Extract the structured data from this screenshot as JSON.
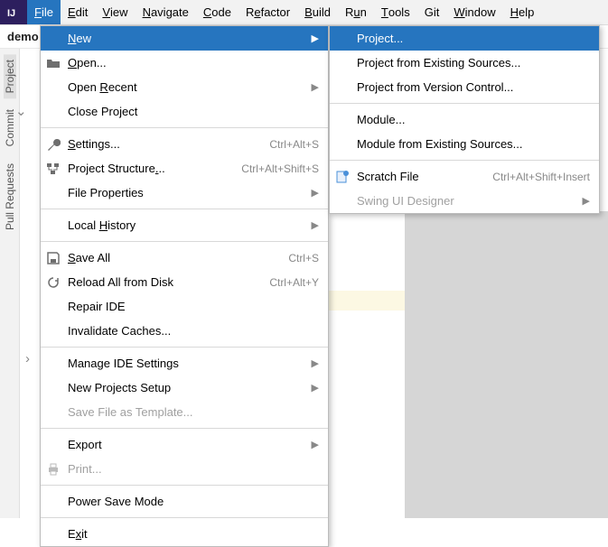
{
  "menubar": [
    "File",
    "Edit",
    "View",
    "Navigate",
    "Code",
    "Refactor",
    "Build",
    "Run",
    "Tools",
    "Git",
    "Window",
    "Help"
  ],
  "menubar_underline_idx": [
    0,
    0,
    0,
    0,
    0,
    1,
    0,
    1,
    0,
    -1,
    0,
    0
  ],
  "menubar_active": 0,
  "crumb": "demo",
  "left_tools": [
    {
      "label": "Project",
      "icon": "project"
    },
    {
      "label": "Commit",
      "icon": "commit"
    },
    {
      "label": "Pull Requests",
      "icon": "pr"
    }
  ],
  "file_menu": [
    {
      "label": "New",
      "underline": 0,
      "arrow": true,
      "highlight": true
    },
    {
      "icon": "open",
      "label": "Open...",
      "underline": 0
    },
    {
      "label": "Open Recent",
      "underline": 5,
      "arrow": true
    },
    {
      "label": "Close Project"
    },
    {
      "sep": true
    },
    {
      "icon": "wrench",
      "label": "Settings...",
      "underline": 0,
      "short": "Ctrl+Alt+S"
    },
    {
      "icon": "structure",
      "label": "Project Structure...",
      "underline": 17,
      "short": "Ctrl+Alt+Shift+S"
    },
    {
      "label": "File Properties",
      "arrow": true
    },
    {
      "sep": true
    },
    {
      "label": "Local History",
      "underline": 6,
      "arrow": true
    },
    {
      "sep": true
    },
    {
      "icon": "save",
      "label": "Save All",
      "underline": 0,
      "short": "Ctrl+S"
    },
    {
      "icon": "reload",
      "label": "Reload All from Disk",
      "short": "Ctrl+Alt+Y"
    },
    {
      "label": "Repair IDE"
    },
    {
      "label": "Invalidate Caches..."
    },
    {
      "sep": true
    },
    {
      "label": "Manage IDE Settings",
      "arrow": true
    },
    {
      "label": "New Projects Setup",
      "arrow": true
    },
    {
      "label": "Save File as Template...",
      "disabled": true
    },
    {
      "sep": true
    },
    {
      "label": "Export",
      "arrow": true
    },
    {
      "icon": "print",
      "label": "Print...",
      "disabled": true
    },
    {
      "sep": true
    },
    {
      "label": "Power Save Mode"
    },
    {
      "sep": true
    },
    {
      "label": "Exit",
      "underline": 1
    }
  ],
  "new_submenu": [
    {
      "label": "Project...",
      "highlight": true
    },
    {
      "label": "Project from Existing Sources..."
    },
    {
      "label": "Project from Version Control..."
    },
    {
      "sep": true
    },
    {
      "label": "Module..."
    },
    {
      "label": "Module from Existing Sources..."
    },
    {
      "sep": true
    },
    {
      "icon": "scratch",
      "label": "Scratch File",
      "short": "Ctrl+Alt+Shift+Insert"
    },
    {
      "label": "Swing UI Designer",
      "arrow": true,
      "disabled": true
    }
  ]
}
